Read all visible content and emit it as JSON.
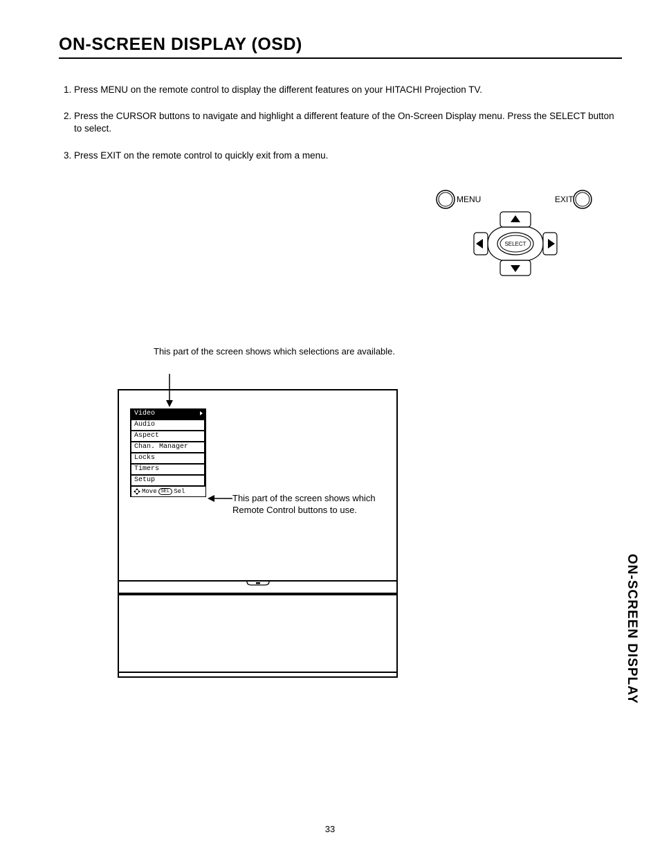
{
  "title": "ON-SCREEN DISPLAY (OSD)",
  "steps": [
    "Press MENU on the remote control to display the different features on your HITACHI Projection TV.",
    "Press the CURSOR buttons to navigate and highlight a different feature of the On-Screen Display menu. Press the SELECT button to select.",
    "Press EXIT on the remote control to quickly exit from a menu."
  ],
  "remote": {
    "menu_label": "MENU",
    "exit_label": "EXIT",
    "select_label": "SELECT"
  },
  "callout_top": "This part of the screen shows which selections are available.",
  "callout_right": "This part of the screen shows which Remote Control buttons to use.",
  "osd_items": [
    "Video",
    "Audio",
    "Aspect",
    "Chan. Manager",
    "Locks",
    "Timers",
    "Setup"
  ],
  "osd_hint_move": "Move",
  "osd_hint_sel_oval": "SEL",
  "osd_hint_sel": "Sel",
  "sidetab": "ON-SCREEN DISPLAY",
  "page_number": "33"
}
